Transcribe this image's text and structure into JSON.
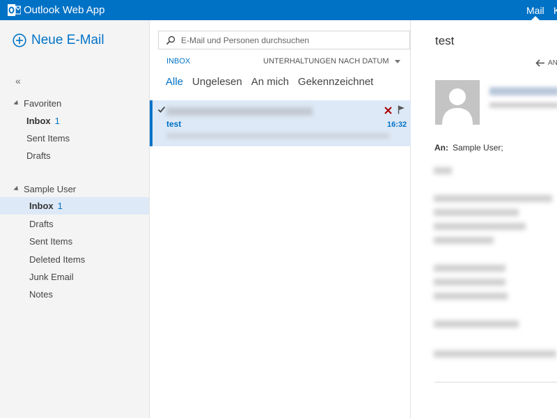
{
  "topbar": {
    "app_title": "Outlook Web App",
    "mail_link": "Mail",
    "next_link_partial": "K"
  },
  "nav": {
    "new_mail_label": "Neue E-Mail",
    "collapse_glyph": "«",
    "favorites": {
      "label": "Favoriten",
      "items": [
        {
          "label": "Inbox",
          "count": "1"
        },
        {
          "label": "Sent Items"
        },
        {
          "label": "Drafts"
        }
      ]
    },
    "mailbox": {
      "label": "Sample User",
      "items": [
        {
          "label": "Inbox",
          "count": "1"
        },
        {
          "label": "Drafts"
        },
        {
          "label": "Sent Items"
        },
        {
          "label": "Deleted Items"
        },
        {
          "label": "Junk Email"
        },
        {
          "label": "Notes"
        }
      ]
    }
  },
  "list": {
    "search_placeholder": "E-Mail und Personen durchsuchen",
    "folder_label": "INBOX",
    "sort_label": "UNTERHALTUNGEN NACH DATUM",
    "filters": [
      "Alle",
      "Ungelesen",
      "An mich",
      "Gekennzeichnet"
    ],
    "messages": [
      {
        "subject": "test",
        "time": "16:32"
      }
    ]
  },
  "reading": {
    "subject": "test",
    "reply_partial": "AN",
    "to_label": "An:",
    "to_value": "Sample User;"
  },
  "colors": {
    "brand": "#0072c6",
    "selected_bg": "#dde9f6",
    "delete_red": "#a80000"
  }
}
